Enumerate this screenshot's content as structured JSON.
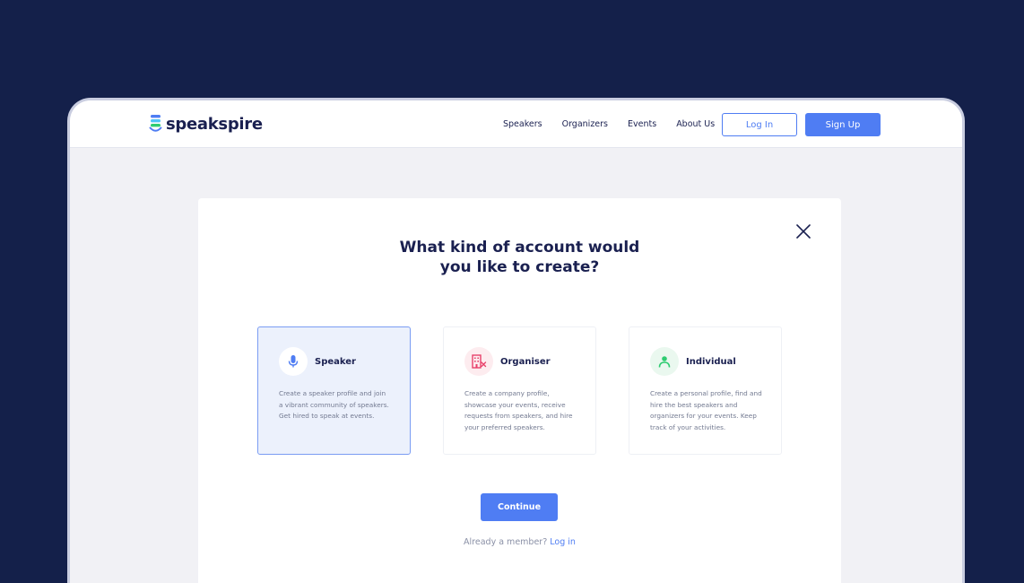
{
  "brand": {
    "name": "speakspire"
  },
  "nav": {
    "links": [
      {
        "label": "Speakers"
      },
      {
        "label": "Organizers"
      },
      {
        "label": "Events"
      },
      {
        "label": "About Us"
      }
    ],
    "login_label": "Log In",
    "signup_label": "Sign Up"
  },
  "modal": {
    "title_line1": "What kind of account would",
    "title_line2": "you like to create?",
    "cards": [
      {
        "title": "Speaker",
        "icon": "microphone-icon",
        "selected": true,
        "description": "Create a speaker profile and join a vibrant community of speakers. Get hired to speak at events."
      },
      {
        "title": "Organiser",
        "icon": "building-icon",
        "selected": false,
        "description": "Create a company profile, showcase your events, receive requests from speakers, and hire your preferred speakers."
      },
      {
        "title": "Individual",
        "icon": "person-icon",
        "selected": false,
        "description": "Create a personal profile, find and hire the best speakers and organizers for your events. Keep track of your activities."
      }
    ],
    "continue_label": "Continue",
    "already_text": "Already a member?",
    "login_link": "Log in"
  },
  "colors": {
    "background": "#14204a",
    "accent": "#4f7df3",
    "heading": "#1a2050",
    "speaker_icon": "#4f7df3",
    "organiser_icon": "#e8416a",
    "individual_icon": "#2ecc71"
  }
}
